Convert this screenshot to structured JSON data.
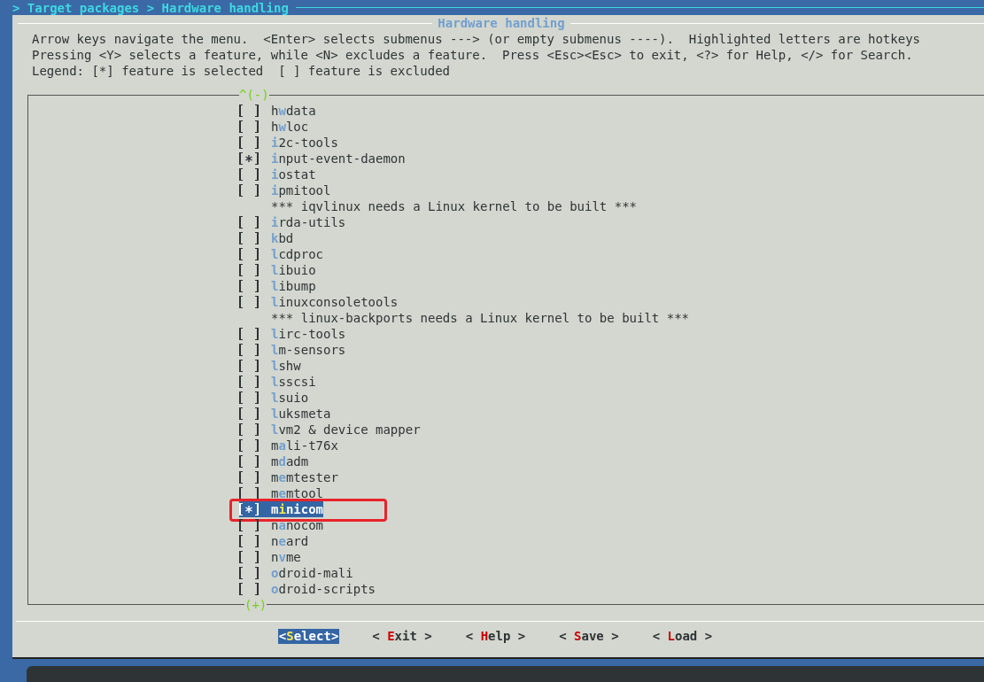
{
  "breadcrumb": "> Target packages > Hardware handling",
  "dialog": {
    "title": "Hardware handling",
    "help_lines": [
      "Arrow keys navigate the menu.  <Enter> selects submenus ---> (or empty submenus ----).  Highlighted letters are hotkeys",
      "Pressing <Y> selects a feature, while <N> excludes a feature.  Press <Esc><Esc> to exit, <?> for Help, </> for Search.",
      "Legend: [*] feature is selected  [ ] feature is excluded"
    ],
    "scroll_up": "^(-)",
    "scroll_down": "(+)",
    "items": [
      {
        "kind": "option",
        "before": "h",
        "hotkey": "w",
        "after": "data",
        "checked": false,
        "selected": false,
        "annotated": false
      },
      {
        "kind": "option",
        "before": "h",
        "hotkey": "w",
        "after": "loc",
        "checked": false,
        "selected": false,
        "annotated": false
      },
      {
        "kind": "option",
        "hotkey": "i",
        "after": "2c-tools",
        "checked": false,
        "selected": false,
        "annotated": false
      },
      {
        "kind": "option",
        "hotkey": "i",
        "after": "nput-event-daemon",
        "checked": true,
        "selected": false,
        "annotated": false
      },
      {
        "kind": "option",
        "hotkey": "i",
        "after": "ostat",
        "checked": false,
        "selected": false,
        "annotated": false
      },
      {
        "kind": "option",
        "hotkey": "i",
        "after": "pmitool",
        "checked": false,
        "selected": false,
        "annotated": false
      },
      {
        "kind": "comment",
        "text": "*** iqvlinux needs a Linux kernel to be built ***"
      },
      {
        "kind": "option",
        "hotkey": "i",
        "after": "rda-utils",
        "checked": false,
        "selected": false,
        "annotated": false
      },
      {
        "kind": "option",
        "hotkey": "k",
        "after": "bd",
        "checked": false,
        "selected": false,
        "annotated": false
      },
      {
        "kind": "option",
        "hotkey": "l",
        "after": "cdproc",
        "checked": false,
        "selected": false,
        "annotated": false
      },
      {
        "kind": "option",
        "hotkey": "l",
        "after": "ibuio",
        "checked": false,
        "selected": false,
        "annotated": false
      },
      {
        "kind": "option",
        "hotkey": "l",
        "after": "ibump",
        "checked": false,
        "selected": false,
        "annotated": false
      },
      {
        "kind": "option",
        "hotkey": "l",
        "after": "inuxconsoletools",
        "checked": false,
        "selected": false,
        "annotated": false
      },
      {
        "kind": "comment",
        "text": "*** linux-backports needs a Linux kernel to be built ***"
      },
      {
        "kind": "option",
        "hotkey": "l",
        "after": "irc-tools",
        "checked": false,
        "selected": false,
        "annotated": false
      },
      {
        "kind": "option",
        "hotkey": "l",
        "after": "m-sensors",
        "checked": false,
        "selected": false,
        "annotated": false
      },
      {
        "kind": "option",
        "hotkey": "l",
        "after": "shw",
        "checked": false,
        "selected": false,
        "annotated": false
      },
      {
        "kind": "option",
        "hotkey": "l",
        "after": "sscsi",
        "checked": false,
        "selected": false,
        "annotated": false
      },
      {
        "kind": "option",
        "hotkey": "l",
        "after": "suio",
        "checked": false,
        "selected": false,
        "annotated": false
      },
      {
        "kind": "option",
        "hotkey": "l",
        "after": "uksmeta",
        "checked": false,
        "selected": false,
        "annotated": false
      },
      {
        "kind": "option",
        "hotkey": "l",
        "after": "vm2 & device mapper",
        "checked": false,
        "selected": false,
        "annotated": false
      },
      {
        "kind": "option",
        "before": "m",
        "hotkey": "a",
        "after": "li-t76x",
        "checked": false,
        "selected": false,
        "annotated": false
      },
      {
        "kind": "option",
        "before": "m",
        "hotkey": "d",
        "after": "adm",
        "checked": false,
        "selected": false,
        "annotated": false
      },
      {
        "kind": "option",
        "before": "m",
        "hotkey": "e",
        "after": "mtester",
        "checked": false,
        "selected": false,
        "annotated": false
      },
      {
        "kind": "option",
        "before": "m",
        "hotkey": "e",
        "after": "mtool",
        "checked": false,
        "selected": false,
        "annotated": false
      },
      {
        "kind": "option",
        "before": "m",
        "hotkey": "i",
        "after": "nicom",
        "checked": true,
        "selected": true,
        "annotated": true
      },
      {
        "kind": "option",
        "before": "n",
        "hotkey": "a",
        "after": "nocom",
        "checked": false,
        "selected": false,
        "annotated": false
      },
      {
        "kind": "option",
        "before": "n",
        "hotkey": "e",
        "after": "ard",
        "checked": false,
        "selected": false,
        "annotated": false
      },
      {
        "kind": "option",
        "before": "n",
        "hotkey": "v",
        "after": "me",
        "checked": false,
        "selected": false,
        "annotated": false
      },
      {
        "kind": "option",
        "hotkey": "o",
        "after": "droid-mali",
        "checked": false,
        "selected": false,
        "annotated": false
      },
      {
        "kind": "option",
        "hotkey": "o",
        "after": "droid-scripts",
        "checked": false,
        "selected": false,
        "annotated": false
      }
    ],
    "buttons": [
      {
        "before": "<",
        "hotkey": "S",
        "after": "elect>",
        "selected": true
      },
      {
        "before": "< ",
        "hotkey": "E",
        "after": "xit >",
        "selected": false
      },
      {
        "before": "< ",
        "hotkey": "H",
        "after": "elp >",
        "selected": false
      },
      {
        "before": "< ",
        "hotkey": "S",
        "after": "ave >",
        "selected": false
      },
      {
        "before": "< ",
        "hotkey": "L",
        "after": "oad >",
        "selected": false
      }
    ]
  }
}
